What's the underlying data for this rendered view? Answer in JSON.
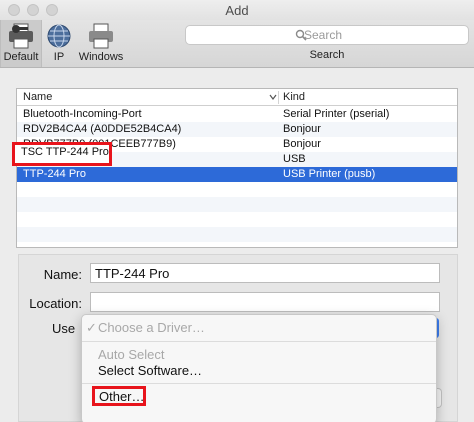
{
  "window": {
    "title": "Add"
  },
  "toolbar": {
    "buttons": [
      {
        "label": "Default",
        "icon": "default-printer-icon",
        "selected": true
      },
      {
        "label": "IP",
        "icon": "globe-icon"
      },
      {
        "label": "Windows",
        "icon": "windows-printer-icon"
      }
    ],
    "search": {
      "placeholder": "Search",
      "label": "Search"
    }
  },
  "printer_list": {
    "columns": [
      "Name",
      "Kind"
    ],
    "rows": [
      {
        "name": "Bluetooth-Incoming-Port",
        "kind": "Serial Printer (pserial)"
      },
      {
        "name": "RDV2B4CA4 (A0DDE52B4CA4)",
        "kind": "Bonjour"
      },
      {
        "name": "RDVB777B9 (001CEEB777B9)",
        "kind": "Bonjour"
      },
      {
        "name": "TSC TTP-244 Pro",
        "kind": "USB"
      },
      {
        "name": "TTP-244 Pro",
        "kind": "USB Printer (pusb)",
        "selected": true
      }
    ]
  },
  "form": {
    "name_label": "Name:",
    "name_value": "TTP-244 Pro",
    "location_label": "Location:",
    "location_value": "",
    "use_label": "Use"
  },
  "driver_menu": {
    "items": [
      {
        "label": "Choose a Driver…",
        "checked": true,
        "disabled": true
      },
      {
        "label": "Auto Select",
        "disabled": true
      },
      {
        "label": "Select Software…"
      },
      {
        "label": "Other…"
      }
    ]
  },
  "colors": {
    "selection": "#2d6ad8",
    "highlight_box": "#e8141c",
    "stepper": "#3d7ef0"
  }
}
